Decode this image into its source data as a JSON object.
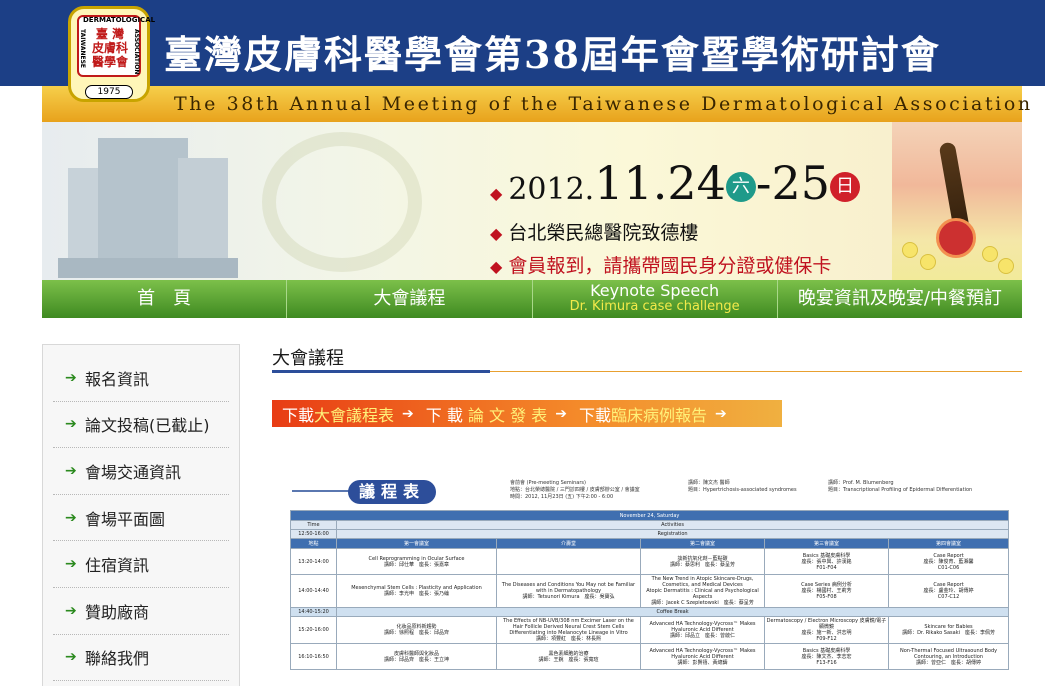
{
  "header": {
    "logo": {
      "arc_top": "DERMATOLOGICAL",
      "side_left": "TAIWANESE",
      "side_right": "ASSOCIATION",
      "cn": "臺 灣\n皮膚科\n醫學會",
      "year": "1975"
    },
    "title_cn": "臺灣皮膚科醫學會第38屆年會暨學術研討會",
    "title_en": "The 38th Annual Meeting of the Taiwanese Dermatological Association"
  },
  "banner": {
    "date_prefix": "2012.",
    "date_main": "11.24",
    "day1": "六",
    "date_sep": "-25",
    "day2": "日",
    "location": "台北榮民總醫院致德樓",
    "notice": "會員報到，請攜帶國民身分證或健保卡",
    "colors": {
      "day1_bg": "#1f9a8a",
      "day2_bg": "#d0202a"
    }
  },
  "nav": {
    "items": [
      {
        "label": "首　頁"
      },
      {
        "label": "大會議程"
      },
      {
        "label": "Keynote Speech",
        "sublabel": "Dr. Kimura case challenge"
      },
      {
        "label": "晚宴資訊及晚宴/中餐預訂"
      }
    ]
  },
  "sidebar": {
    "items": [
      {
        "label": "報名資訊"
      },
      {
        "label": "論文投稿(已截止)"
      },
      {
        "label": "會場交通資訊"
      },
      {
        "label": "會場平面圖"
      },
      {
        "label": "住宿資訊"
      },
      {
        "label": "贊助廠商"
      },
      {
        "label": "聯絡我們"
      }
    ]
  },
  "main": {
    "title": "大會議程",
    "download": {
      "prefix1": "下載",
      "link1": "大會議程表",
      "prefix2": "下 載",
      "link2": "論 文 發 表",
      "prefix3": "下載",
      "link3": "臨床病例報告"
    }
  },
  "agenda": {
    "badge": "議程表",
    "note1": "會前會 (Pre-meeting Seminars)\n地點：台北榮總醫院 / 三門診四樓 / 皮膚部辦公室 / 會議室\n時間：2012, 11月23日 (五) 下午2:00 - 6:00",
    "note2": "講師：陳文杰 醫師\n題目：Hypertrichosis-associated syndromes",
    "note3": "講師：Prof. M. Blumenberg\n題目：Transcriptional Profiling of Epidermal Differentiation",
    "date_header": "November 24, Saturday",
    "time_label": "Time",
    "activities_label": "Activities",
    "registration_time": "12:50-16:00",
    "registration_label": "Registration",
    "col_place": "地點",
    "rooms": [
      "第一會議室",
      "介壽堂",
      "第二會議室",
      "第三會議室",
      "第四會議室"
    ],
    "coffee_time": "14:40-15:20",
    "coffee_label": "Coffee Break",
    "rows": [
      {
        "time": "13:20-14:00",
        "cells": [
          "Cell Reprogramming in Ocular Surface\n講師：邱仕華　座長：張嘉章",
          "",
          "談新抗氧化劑－藍點碳\n講師：蔡思利　座長：蔡呈芳",
          "Basics 基礎皮膚科學\n座長：張中興、許漢銘\nF01-F04",
          "Case Report\n座長：陳俊育、藍湘馨\nC01-C06"
        ]
      },
      {
        "time": "14:00-14:40",
        "cells": [
          "Mesenchymal Stem Cells : Plasticity and Application\n講師：李光申　座長：張乃綸",
          "The Diseases and Conditions You May not be Familiar with in Dermatopathology\n講師：Tetsunori Kimura　座長：吳寶弘",
          "The New Trend in Atopic Skincare-Drugs, Cosmetics, and Medical Devices\nAtopic Dermatitis : Clinical and Psychological Aspects\n講師：Jacek C Szepietowski　座長：蔡呈芳",
          "Case Series 病例分析\n座長：楊國村、王莉芳\nF05-F08",
          "Case Report\n座長：盧金玲、胡傳婷\nC07-C12"
        ]
      },
      {
        "time": "15:20-16:00",
        "cells": [
          "化妝品原料新趨勢\n講師：徐照程　座長：邱品齊",
          "The Effects of NB-UVB/308 nm Excimer Laser on the Hair Follicle Derived Neural Crest Stem Cells Differentiating into Melanocyte Lineage in Vitro\n講師：項豐紅　座長：林長熙",
          "Advanced HA Technology-Vycross™ Makes Hyaluronic Acid Different\n講師：邱品立　座長：曾啟仁",
          "Dermatoscopy / Electron Microscopy 皮膚鏡/電子顯微鏡\n座長：施一新、洪志明\nF09-F12",
          "Skincare for Babies\n講師：Dr. Rikako Sasaki　座長：李佩芳"
        ]
      },
      {
        "time": "16:10-16:50",
        "cells": [
          "皮膚科醫師與化妝品\n講師：邱品齊　座長：王立坤",
          "黑色素細胞的治療\n講師：王銳　座長：張寬瑄",
          "Advanced HA Technology-Vycross™ Makes Hyaluronic Acid Different\n講師：彭賢禧、黃總鑄",
          "Basics 基礎皮膚科學\n座長：陳文杰、李志宏\nF13-F16",
          "Non-Thermal Focused Ultrasound Body Contouring, an Introduction\n講師：曾亞仁　座長：胡傳婷"
        ]
      }
    ]
  }
}
